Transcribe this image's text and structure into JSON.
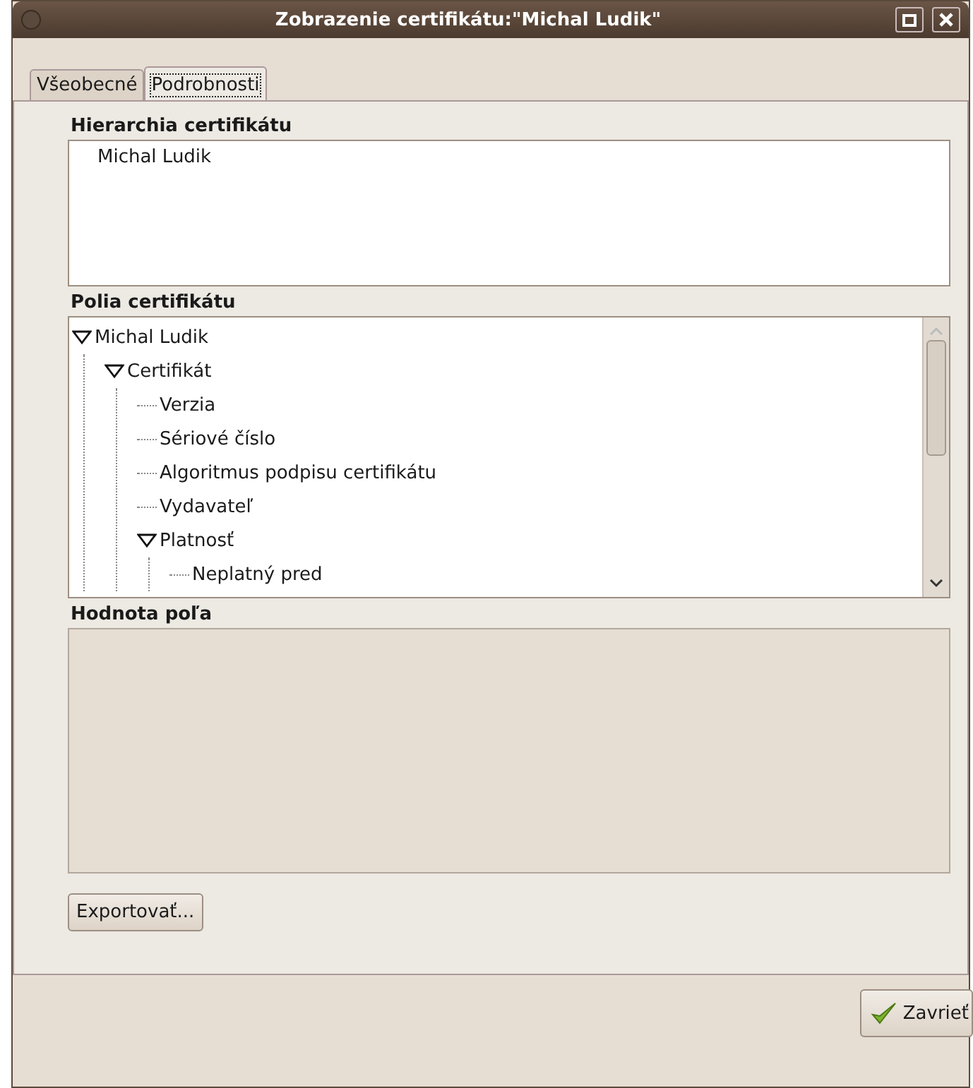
{
  "window": {
    "title": "Zobrazenie certifikátu:\"Michal Ludik\""
  },
  "tabs": [
    {
      "label": "Všeobecné",
      "selected": false
    },
    {
      "label": "Podrobnosti",
      "selected": true
    }
  ],
  "hierarchy": {
    "heading": "Hierarchia certifikátu",
    "items": [
      "Michal Ludik"
    ]
  },
  "fields": {
    "heading": "Polia certifikátu",
    "tree": [
      {
        "label": "Michal Ludik",
        "expanded": true,
        "children": [
          {
            "label": "Certifikát",
            "expanded": true,
            "children": [
              {
                "label": "Verzia"
              },
              {
                "label": "Sériové číslo"
              },
              {
                "label": "Algoritmus podpisu certifikátu"
              },
              {
                "label": "Vydavateľ"
              },
              {
                "label": "Platnosť",
                "expanded": true,
                "children": [
                  {
                    "label": "Neplatný pred"
                  }
                ]
              }
            ]
          }
        ]
      }
    ]
  },
  "value": {
    "heading": "Hodnota poľa"
  },
  "buttons": {
    "export": "Exportovať...",
    "close": "Zavrieť"
  }
}
